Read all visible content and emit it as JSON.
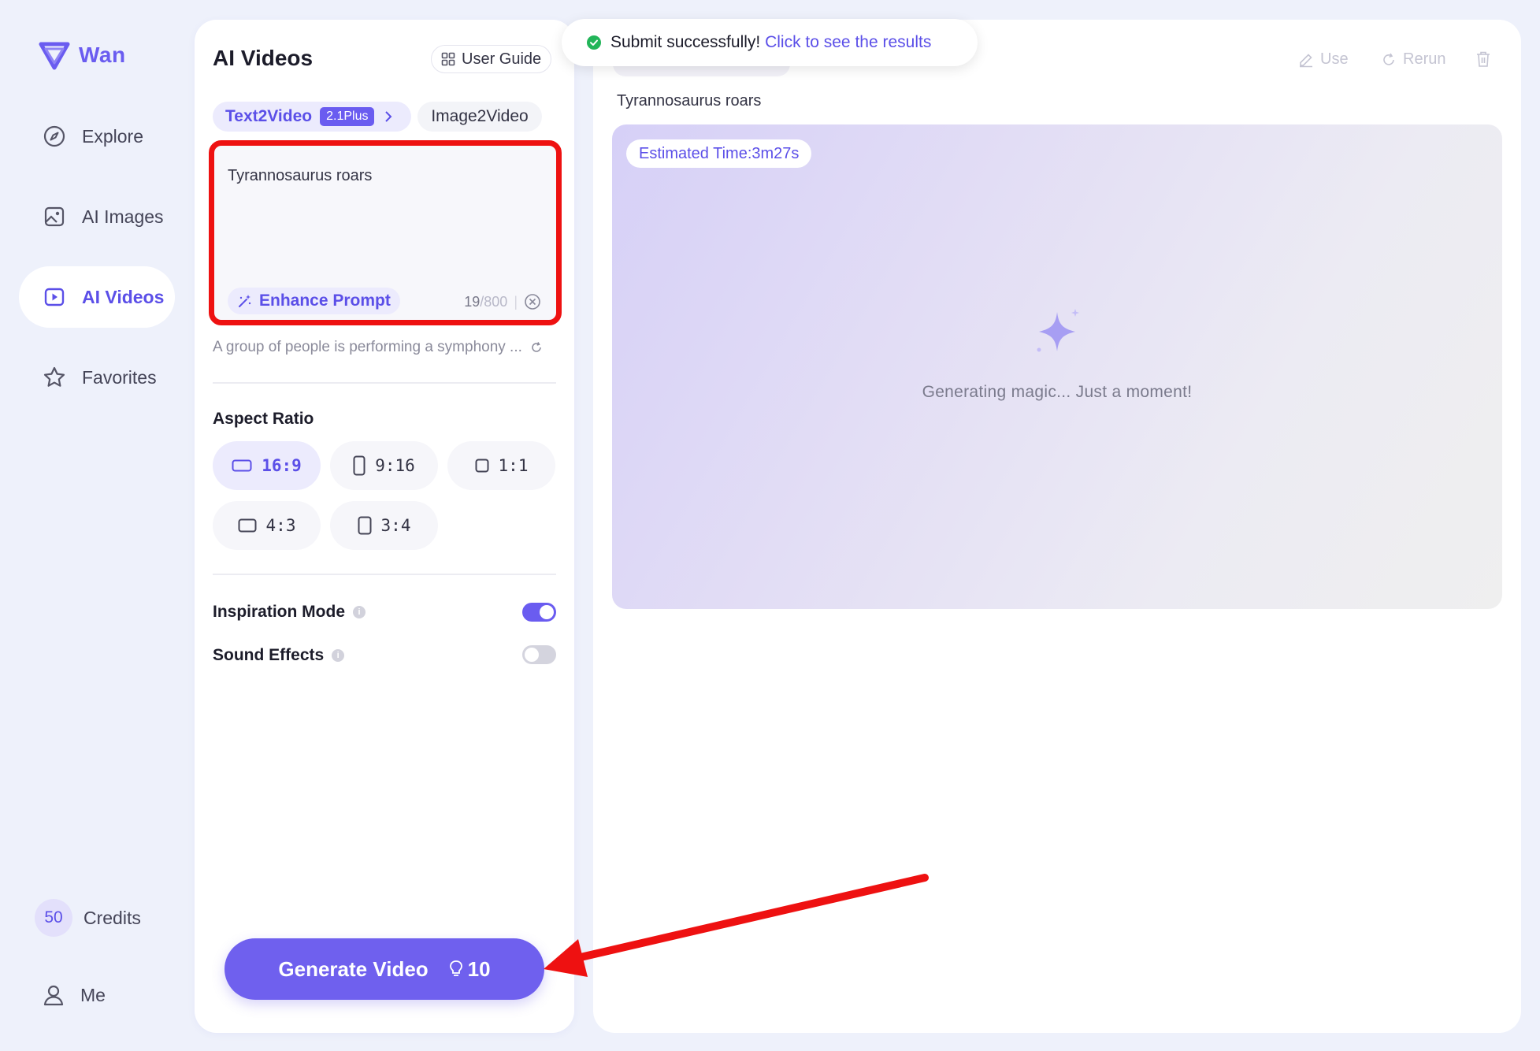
{
  "app": {
    "name": "Wan",
    "brand_color": "#6a5cf0"
  },
  "nav": {
    "items": [
      {
        "label": "Explore",
        "icon": "compass-icon",
        "active": false
      },
      {
        "label": "AI Images",
        "icon": "image-icon",
        "active": false
      },
      {
        "label": "AI Videos",
        "icon": "video-icon",
        "active": true
      },
      {
        "label": "Favorites",
        "icon": "star-icon",
        "active": false
      }
    ],
    "credits": {
      "value": "50",
      "label": "Credits"
    },
    "me_label": "Me"
  },
  "panel": {
    "title": "AI Videos",
    "user_guide_label": "User Guide",
    "tabs": {
      "text2video": {
        "label": "Text2Video",
        "badge": "2.1Plus"
      },
      "image2video": {
        "label": "Image2Video"
      }
    },
    "prompt": {
      "value": "Tyrannosaurus roars",
      "enhance_label": "Enhance Prompt",
      "count": "19",
      "max": "/800"
    },
    "suggestion": "A group of people is performing a symphony ...",
    "aspect_ratio": {
      "label": "Aspect Ratio",
      "options": [
        "16:9",
        "9:16",
        "1:1",
        "4:3",
        "3:4"
      ],
      "selected": "16:9"
    },
    "inspiration_mode": {
      "label": "Inspiration Mode",
      "on": true
    },
    "sound_effects": {
      "label": "Sound Effects",
      "on": false
    },
    "generate": {
      "label": "Generate Video",
      "cost": "10"
    }
  },
  "preview": {
    "actions": {
      "use": "Use",
      "rerun": "Rerun"
    },
    "prompt_echo": "Tyrannosaurus roars",
    "eta": "Estimated Time:3m27s",
    "status": "Generating magic... Just a moment!"
  },
  "toast": {
    "message": "Submit successfully!",
    "link": "Click to see the results",
    "status_color": "#22b559"
  },
  "annotation": {
    "highlight_color": "#ee1111"
  }
}
